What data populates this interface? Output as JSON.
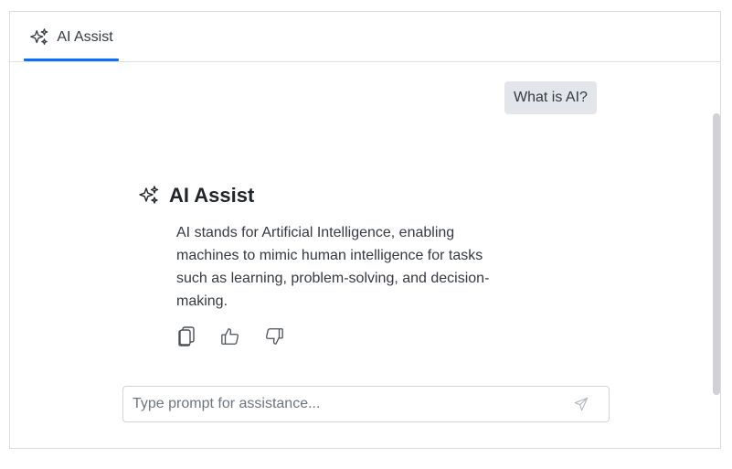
{
  "tab": {
    "label": "AI Assist",
    "icon": "sparkle-icon"
  },
  "conversation": {
    "prompt": "What is AI?",
    "response": {
      "title": "AI Assist",
      "icon": "sparkle-icon",
      "text": "AI stands for Artificial Intelligence, enabling machines to mimic human intelligence for tasks such as learning, problem-solving, and decision-making.",
      "actions": [
        {
          "name": "copy-icon"
        },
        {
          "name": "thumbs-up-icon"
        },
        {
          "name": "thumbs-down-icon"
        }
      ]
    }
  },
  "input": {
    "placeholder": "Type prompt for assistance...",
    "value": "",
    "send_icon": "send-icon"
  },
  "colors": {
    "accent": "#0d6efd",
    "bubble": "#e2e5e9"
  }
}
